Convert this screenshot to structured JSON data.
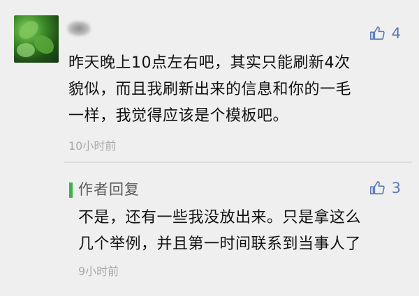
{
  "comment": {
    "like_count": "4",
    "lines": [
      "昨天晚上10点左右吧，其实只能刷新4次",
      "貌似，而且我刷新出来的信息和你的一毛",
      "一样，我觉得应该是个模板吧。"
    ],
    "time": "10小时前"
  },
  "reply": {
    "title": "作者回复",
    "like_count": "3",
    "lines": [
      "不是，还有一些我没放出来。只是拿这么",
      "几个举例，并且第一时间联系到当事人了"
    ],
    "time": "9小时前"
  },
  "icons": {
    "avatar": "avatar-image",
    "like": "thumbs-up-icon"
  },
  "colors": {
    "background": "#efefef",
    "like": "#5b7bb6",
    "reply_accent": "#3db24a",
    "timestamp": "#a8a8a8"
  }
}
